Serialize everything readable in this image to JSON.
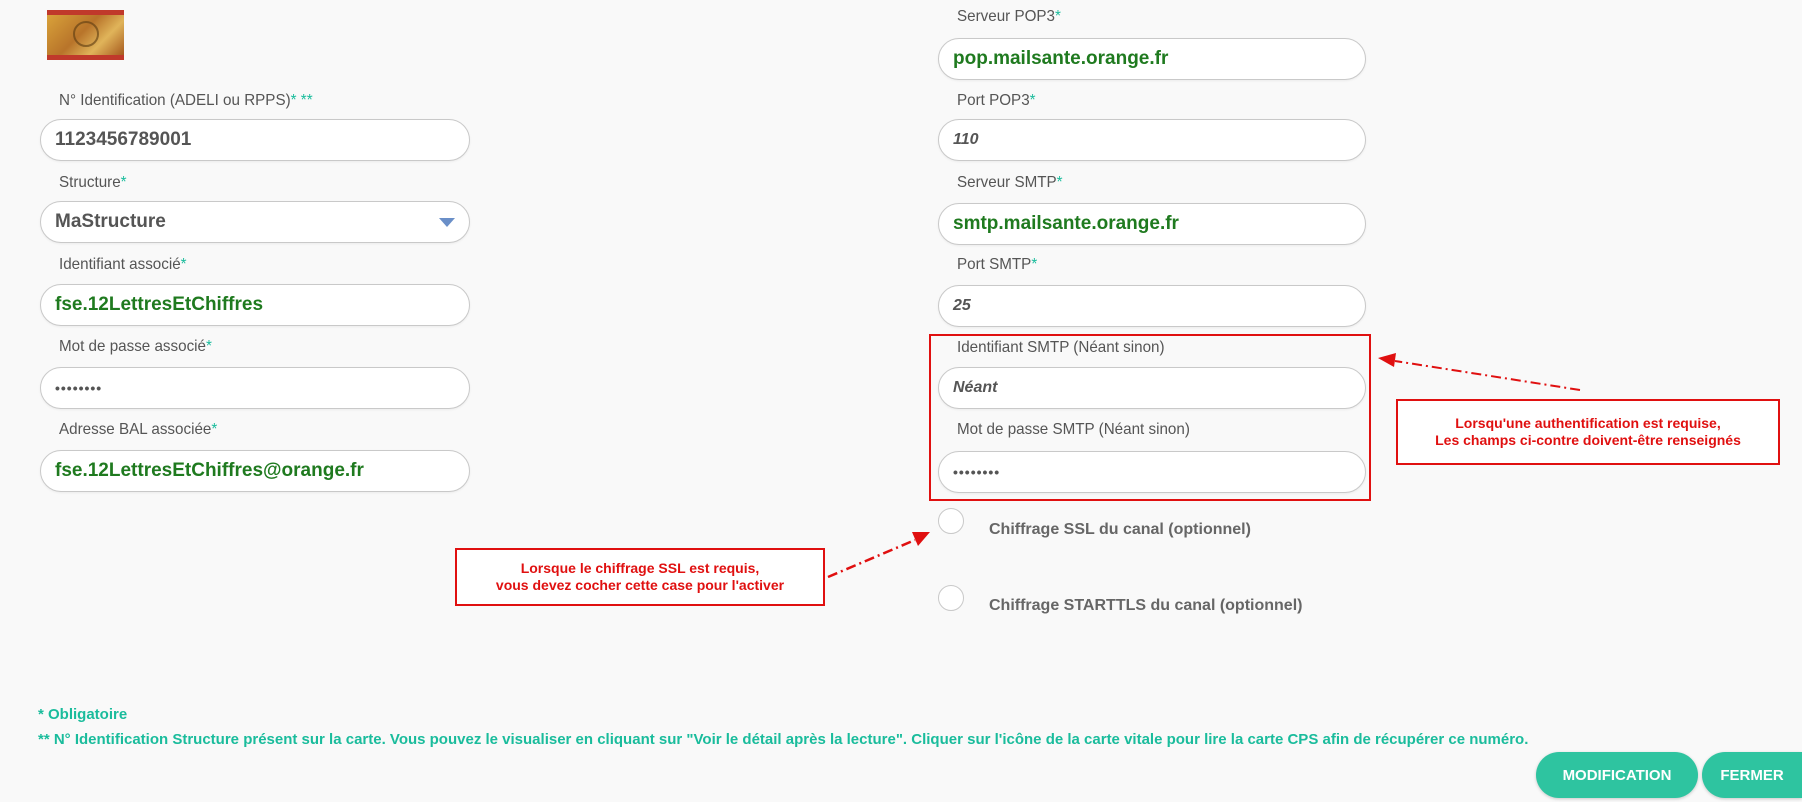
{
  "left": {
    "id_label": "N° Identification (ADELI ou RPPS)",
    "id_req": "* **",
    "id_value": "1123456789001",
    "structure_label": "Structure",
    "structure_value": "MaStructure",
    "ident_label": "Identifiant associé",
    "ident_value": "fse.12LettresEtChiffres",
    "pwd_label": "Mot de passe associé",
    "pwd_value": "••••••••",
    "bal_label": "Adresse BAL associée",
    "bal_value": "fse.12LettresEtChiffres@orange.fr",
    "req": "*"
  },
  "right": {
    "pop_label": "Serveur POP3",
    "pop_value": "pop.mailsante.orange.fr",
    "popport_label": "Port POP3",
    "popport_value": "110",
    "smtp_label": "Serveur SMTP",
    "smtp_value": "smtp.mailsante.orange.fr",
    "smtpport_label": "Port SMTP",
    "smtpport_value": "25",
    "smtpid_label": "Identifiant SMTP (Néant sinon)",
    "smtpid_value": "Néant",
    "smtppwd_label": "Mot de passe SMTP (Néant sinon)",
    "smtppwd_value": "••••••••",
    "ssl_label": "Chiffrage SSL du canal (optionnel)",
    "starttls_label": "Chiffrage STARTTLS du canal (optionnel)",
    "req": "*"
  },
  "annotations": {
    "auth_line1": "Lorsqu'une authentification est requise,",
    "auth_line2": "Les champs ci-contre doivent-être renseignés",
    "ssl_line1": "Lorsque le chiffrage SSL est requis,",
    "ssl_line2": "vous devez cocher cette case pour l'activer"
  },
  "footer": {
    "mandatory": "* Obligatoire",
    "note": "** N° Identification Structure présent sur la carte. Vous pouvez le visualiser en cliquant sur \"Voir le détail après la lecture\". Cliquer sur l'icône de la carte vitale pour lire la carte CPS afin de récupérer ce numéro.",
    "modify_button": "MODIFICATION",
    "close_button": "FERMER"
  },
  "colors": {
    "accent": "#2ec4a0",
    "value_green": "#1f7a1f",
    "annotation_red": "#e01010",
    "caret_blue": "#6a8fc8"
  },
  "icons": {
    "dropdown": "chevron-down-icon",
    "logo": "ordre-logo"
  }
}
